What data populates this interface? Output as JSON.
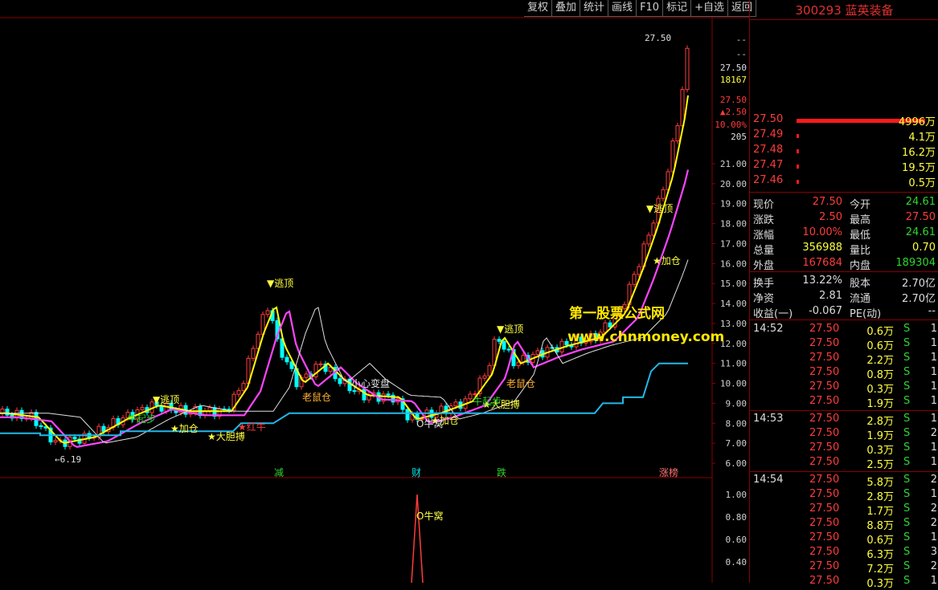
{
  "toolbar": {
    "buttons": [
      "复权",
      "叠加",
      "统计",
      "画线",
      "F10",
      "标记",
      "+自选",
      "返回"
    ]
  },
  "stock": {
    "code_name": "300293 蓝英装备"
  },
  "price_axis": {
    "ticks": [
      "21.00",
      "20.00",
      "19.00",
      "18.00",
      "17.00",
      "16.00",
      "15.00",
      "14.00",
      "13.00",
      "12.00",
      "11.00",
      "10.00",
      "9.00",
      "8.00",
      "7.00",
      "6.00"
    ],
    "top_labels": [
      "--",
      "--",
      "27.50",
      "18167",
      "27.50",
      "▲2.50",
      "10.00%",
      "205"
    ],
    "last_price_label": "27.50",
    "low_label": "←6.19"
  },
  "lower_axis": {
    "ticks": [
      "1.00",
      "0.80",
      "0.60",
      "0.40"
    ]
  },
  "signals": {
    "escape_top": "▼逃顶",
    "add_position": "★加仓",
    "brave": "★大胆搏",
    "red_bull": "★红牛",
    "bull_step": "牛起步",
    "rat_position": "老鼠仓",
    "careful": "小心变盘",
    "bull_nest": "O牛窝",
    "rat_pos2": "老鼠仓",
    "sp1": "牛起步"
  },
  "markers": [
    "减",
    "财",
    "跌",
    "涨榜"
  ],
  "watermark": {
    "line1": "第一股票公式网",
    "line2": "www.chnmoney.com"
  },
  "orderbook": [
    {
      "price": "27.50",
      "vol": "4996万",
      "bar": 160
    },
    {
      "price": "27.49",
      "vol": "4.1万",
      "bar": 3
    },
    {
      "price": "27.48",
      "vol": "16.2万",
      "bar": 3
    },
    {
      "price": "27.47",
      "vol": "19.5万",
      "bar": 3
    },
    {
      "price": "27.46",
      "vol": "0.5万",
      "bar": 3
    }
  ],
  "quote": [
    {
      "l1": "现价",
      "v1": "27.50",
      "c1": "red",
      "l2": "今开",
      "v2": "24.61",
      "c2": "green"
    },
    {
      "l1": "涨跌",
      "v1": "2.50",
      "c1": "red",
      "l2": "最高",
      "v2": "27.50",
      "c2": "red"
    },
    {
      "l1": "涨幅",
      "v1": "10.00%",
      "c1": "red",
      "l2": "最低",
      "v2": "24.61",
      "c2": "green"
    },
    {
      "l1": "总量",
      "v1": "356988",
      "c1": "yellow",
      "l2": "量比",
      "v2": "0.70",
      "c2": "yellow"
    },
    {
      "l1": "外盘",
      "v1": "167684",
      "c1": "red",
      "l2": "内盘",
      "v2": "189304",
      "c2": "green"
    }
  ],
  "stats": [
    {
      "l1": "换手",
      "v1": "13.22%",
      "l2": "股本",
      "v2": "2.70亿"
    },
    {
      "l1": "净资",
      "v1": "2.81",
      "l2": "流通",
      "v2": "2.70亿"
    },
    {
      "l1": "收益(一)",
      "v1": "-0.067",
      "l2": "PE(动)",
      "v2": "--"
    }
  ],
  "ticks": [
    {
      "time": "14:52",
      "price": "27.50",
      "vol": "0.6万",
      "side": "S",
      "n": "1"
    },
    {
      "time": "",
      "price": "27.50",
      "vol": "0.6万",
      "side": "S",
      "n": "1"
    },
    {
      "time": "",
      "price": "27.50",
      "vol": "2.2万",
      "side": "S",
      "n": "1"
    },
    {
      "time": "",
      "price": "27.50",
      "vol": "0.8万",
      "side": "S",
      "n": "1"
    },
    {
      "time": "",
      "price": "27.50",
      "vol": "0.3万",
      "side": "S",
      "n": "1"
    },
    {
      "time": "",
      "price": "27.50",
      "vol": "1.9万",
      "side": "S",
      "n": "1"
    },
    {
      "time": "14:53",
      "price": "27.50",
      "vol": "2.8万",
      "side": "S",
      "n": "1"
    },
    {
      "time": "",
      "price": "27.50",
      "vol": "1.9万",
      "side": "S",
      "n": "2"
    },
    {
      "time": "",
      "price": "27.50",
      "vol": "0.3万",
      "side": "S",
      "n": "1"
    },
    {
      "time": "",
      "price": "27.50",
      "vol": "2.5万",
      "side": "S",
      "n": "1"
    },
    {
      "time": "14:54",
      "price": "27.50",
      "vol": "5.8万",
      "side": "S",
      "n": "2"
    },
    {
      "time": "",
      "price": "27.50",
      "vol": "2.8万",
      "side": "S",
      "n": "1"
    },
    {
      "time": "",
      "price": "27.50",
      "vol": "1.7万",
      "side": "S",
      "n": "2"
    },
    {
      "time": "",
      "price": "27.50",
      "vol": "8.8万",
      "side": "S",
      "n": "2"
    },
    {
      "time": "",
      "price": "27.50",
      "vol": "0.6万",
      "side": "S",
      "n": "1"
    },
    {
      "time": "",
      "price": "27.50",
      "vol": "6.3万",
      "side": "S",
      "n": "3"
    },
    {
      "time": "",
      "price": "27.50",
      "vol": "7.2万",
      "side": "S",
      "n": "2"
    },
    {
      "time": "",
      "price": "27.50",
      "vol": "0.3万",
      "side": "S",
      "n": "1"
    }
  ],
  "colors": {
    "rise": "#ff3b3b",
    "fall": "#00ffff",
    "ma_yellow": "#ffff00",
    "ma_magenta": "#ff44ff",
    "ma_white": "#e0e0e0",
    "support": "#22b8e8",
    "grid": "#8b0000"
  }
}
